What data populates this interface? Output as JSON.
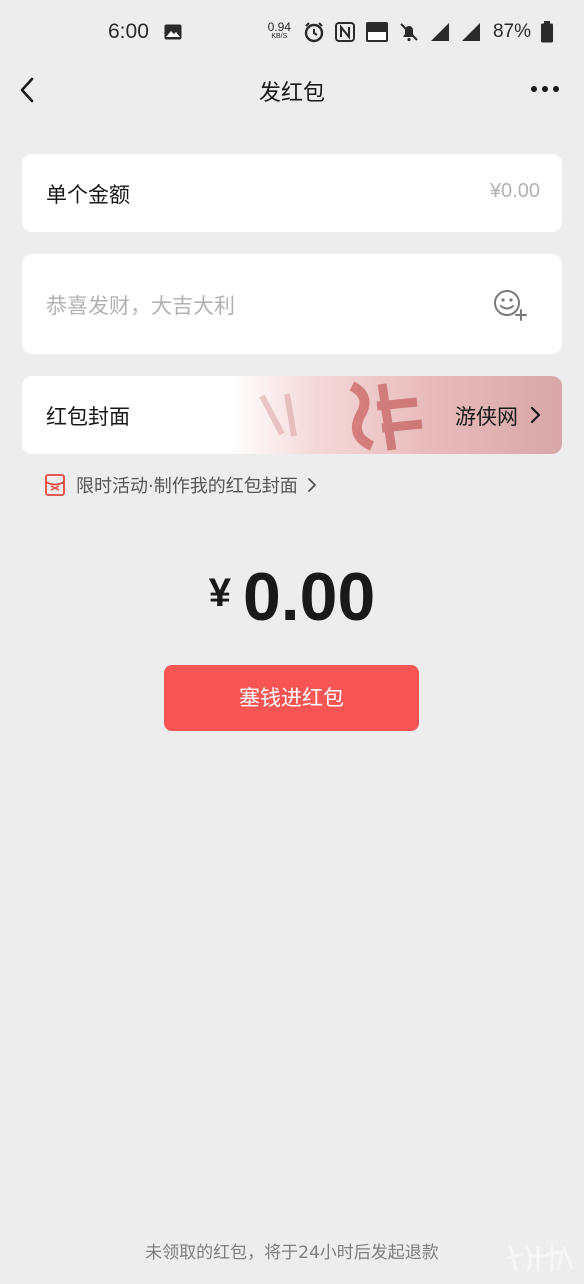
{
  "status_bar": {
    "time": "6:00",
    "net_speed_value": "0.94",
    "net_speed_unit": "KB/S",
    "battery": "87%",
    "icons": [
      "gallery-icon",
      "alarm-icon",
      "nfc-icon",
      "volte-icon",
      "mute-icon",
      "signal-4g-icon",
      "signal-4g-icon",
      "battery-icon"
    ]
  },
  "nav": {
    "title": "发红包"
  },
  "amount": {
    "label": "单个金额",
    "placeholder": "¥0.00"
  },
  "greeting": {
    "placeholder": "恭喜发财，大吉大利"
  },
  "cover": {
    "label": "红包封面",
    "value": "游侠网"
  },
  "promo": {
    "text": "限时活动·制作我的红包封面"
  },
  "total": {
    "currency": "¥",
    "value": "0.00"
  },
  "submit_button": {
    "label": "塞钱进红包"
  },
  "footer": {
    "note": "未领取的红包，将于24小时后发起退款"
  },
  "colors": {
    "background": "#ededed",
    "card": "#ffffff",
    "accent": "#f75553",
    "placeholder": "#b2b2b2"
  }
}
